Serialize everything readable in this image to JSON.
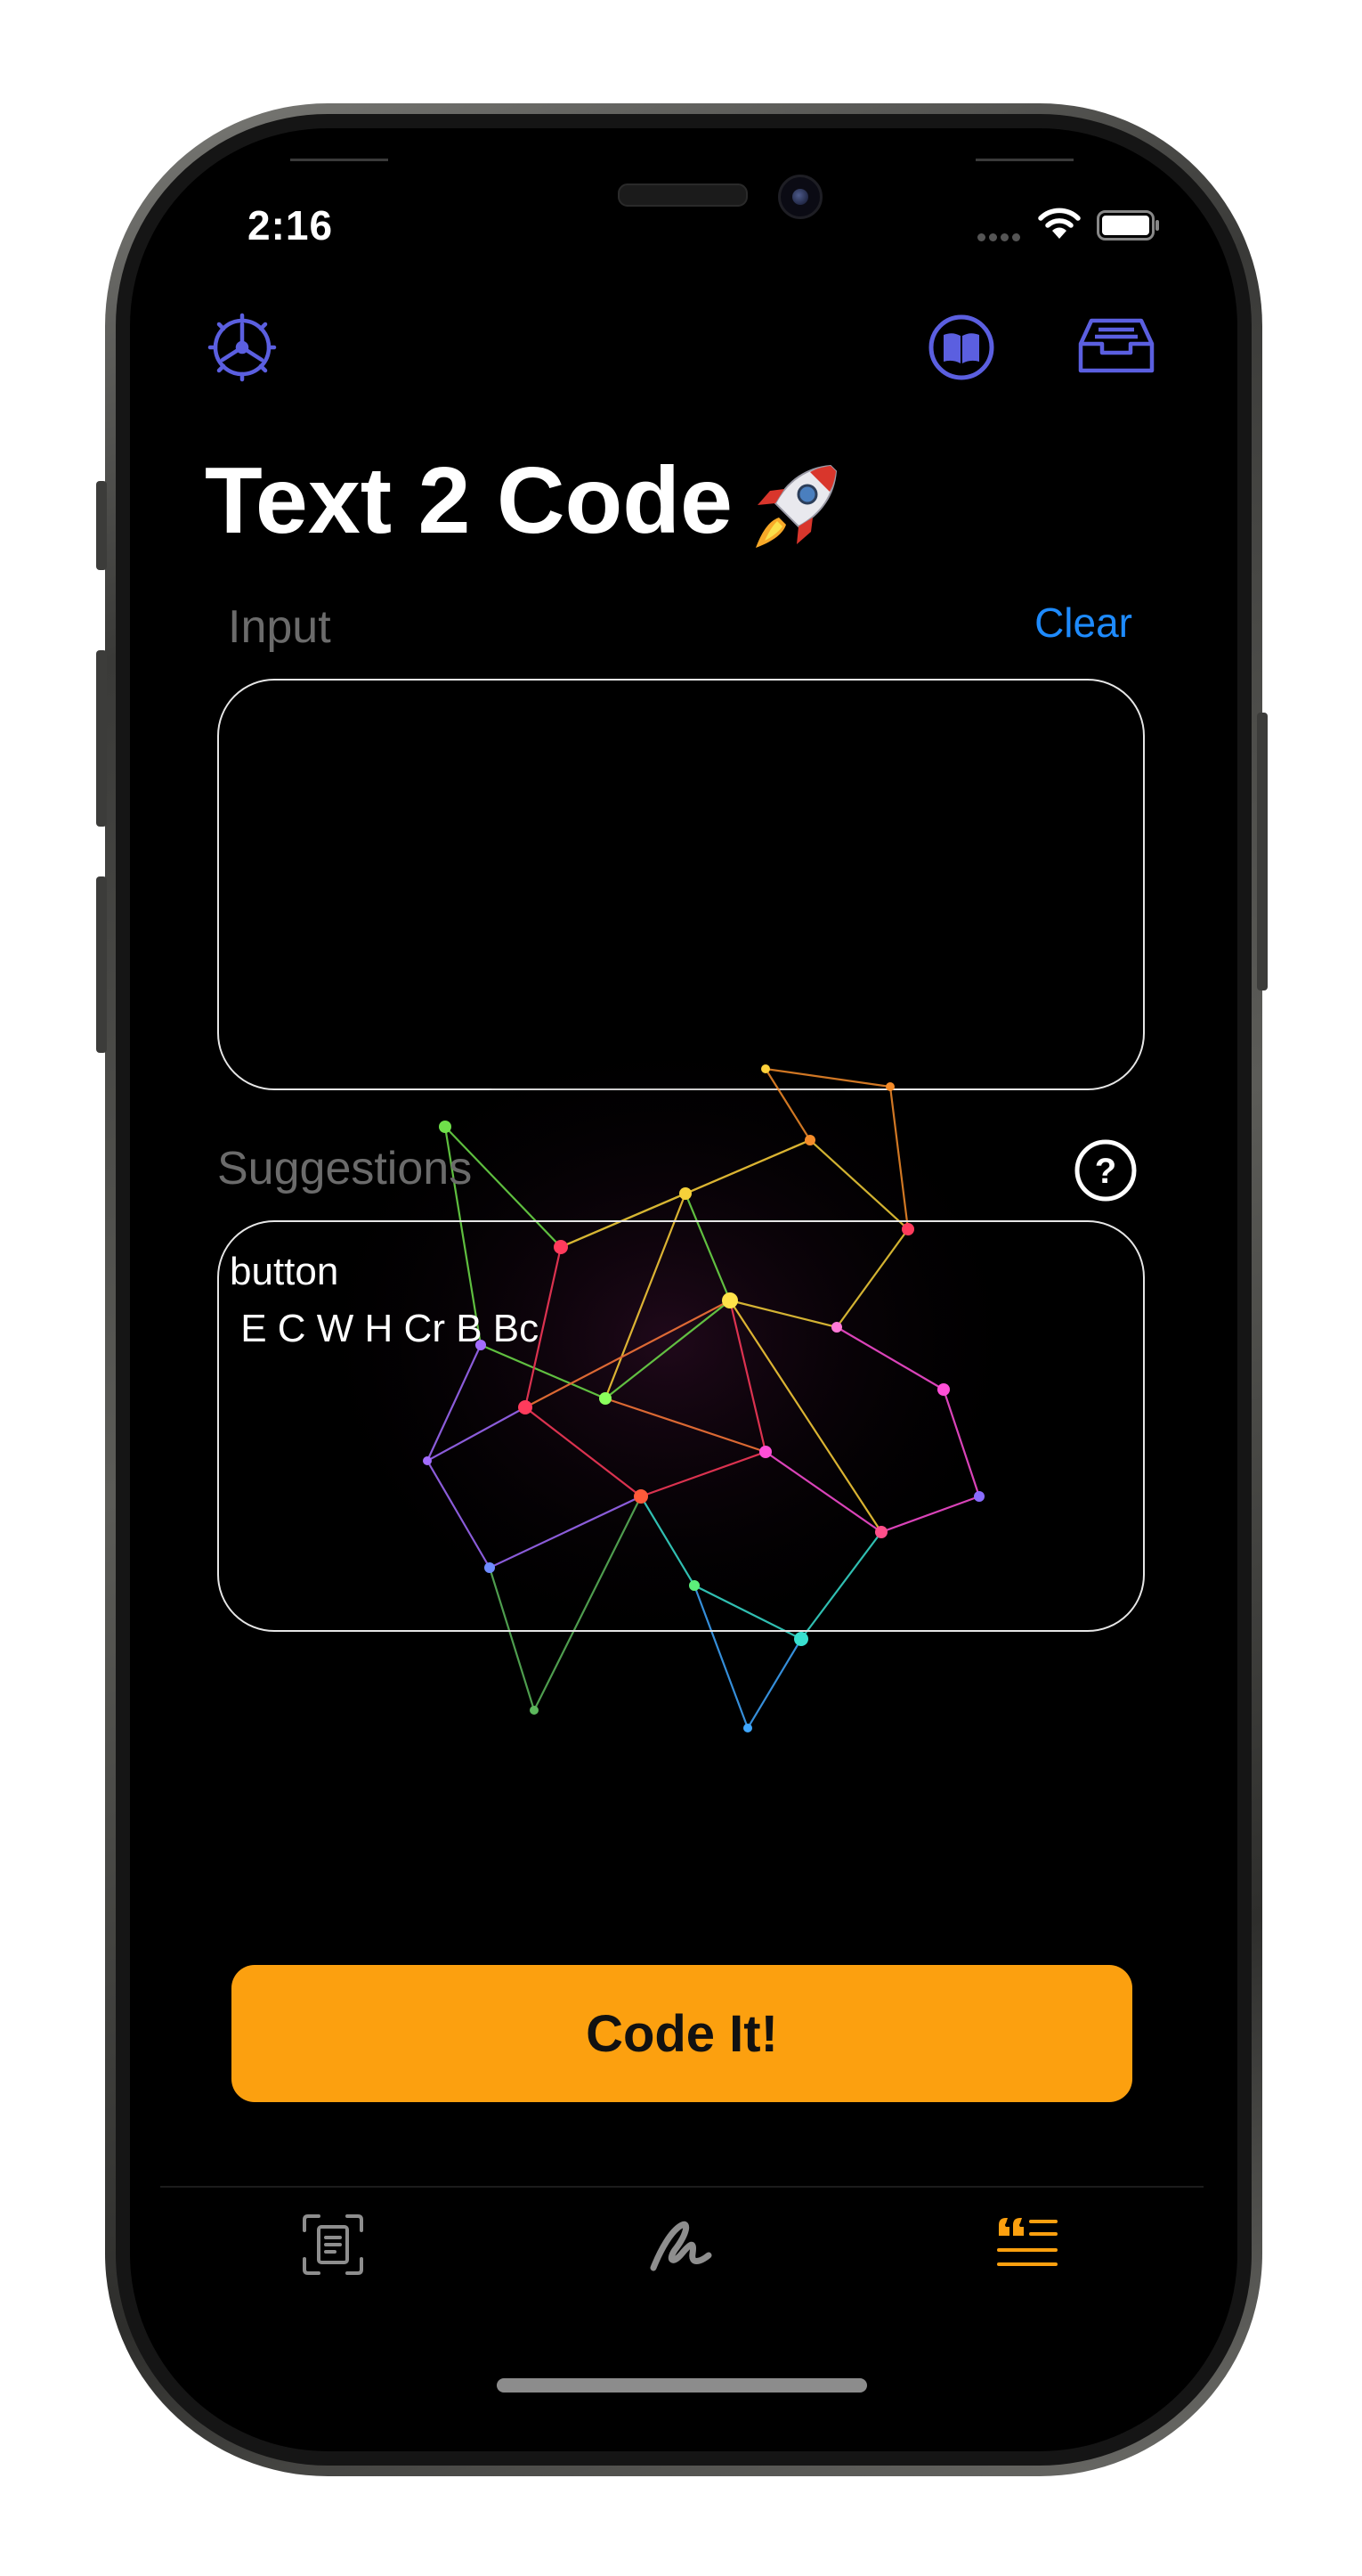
{
  "status_bar": {
    "time": "2:16"
  },
  "header": {
    "title": "Text 2 Code"
  },
  "input_section": {
    "label": "Input",
    "clear_label": "Clear",
    "value": ""
  },
  "suggestions_section": {
    "label": "Suggestions",
    "lines": [
      "button",
      " E C W H Cr B Bc"
    ]
  },
  "action": {
    "label": "Code It!"
  },
  "colors": {
    "accent_purple": "#5b5fe0",
    "accent_orange": "#fca00f",
    "link_blue": "#1e8bff",
    "tab_inactive": "#8e8e8e"
  },
  "icons": {
    "settings": "gear-icon",
    "docs": "book-icon",
    "inbox": "tray-icon",
    "help": "question-mark-icon",
    "tab_scan": "document-scanner-icon",
    "tab_draw": "scribble-icon",
    "tab_text": "quote-text-icon"
  },
  "tabs": [
    {
      "id": "scan",
      "active": false
    },
    {
      "id": "draw",
      "active": false
    },
    {
      "id": "text",
      "active": true
    }
  ]
}
